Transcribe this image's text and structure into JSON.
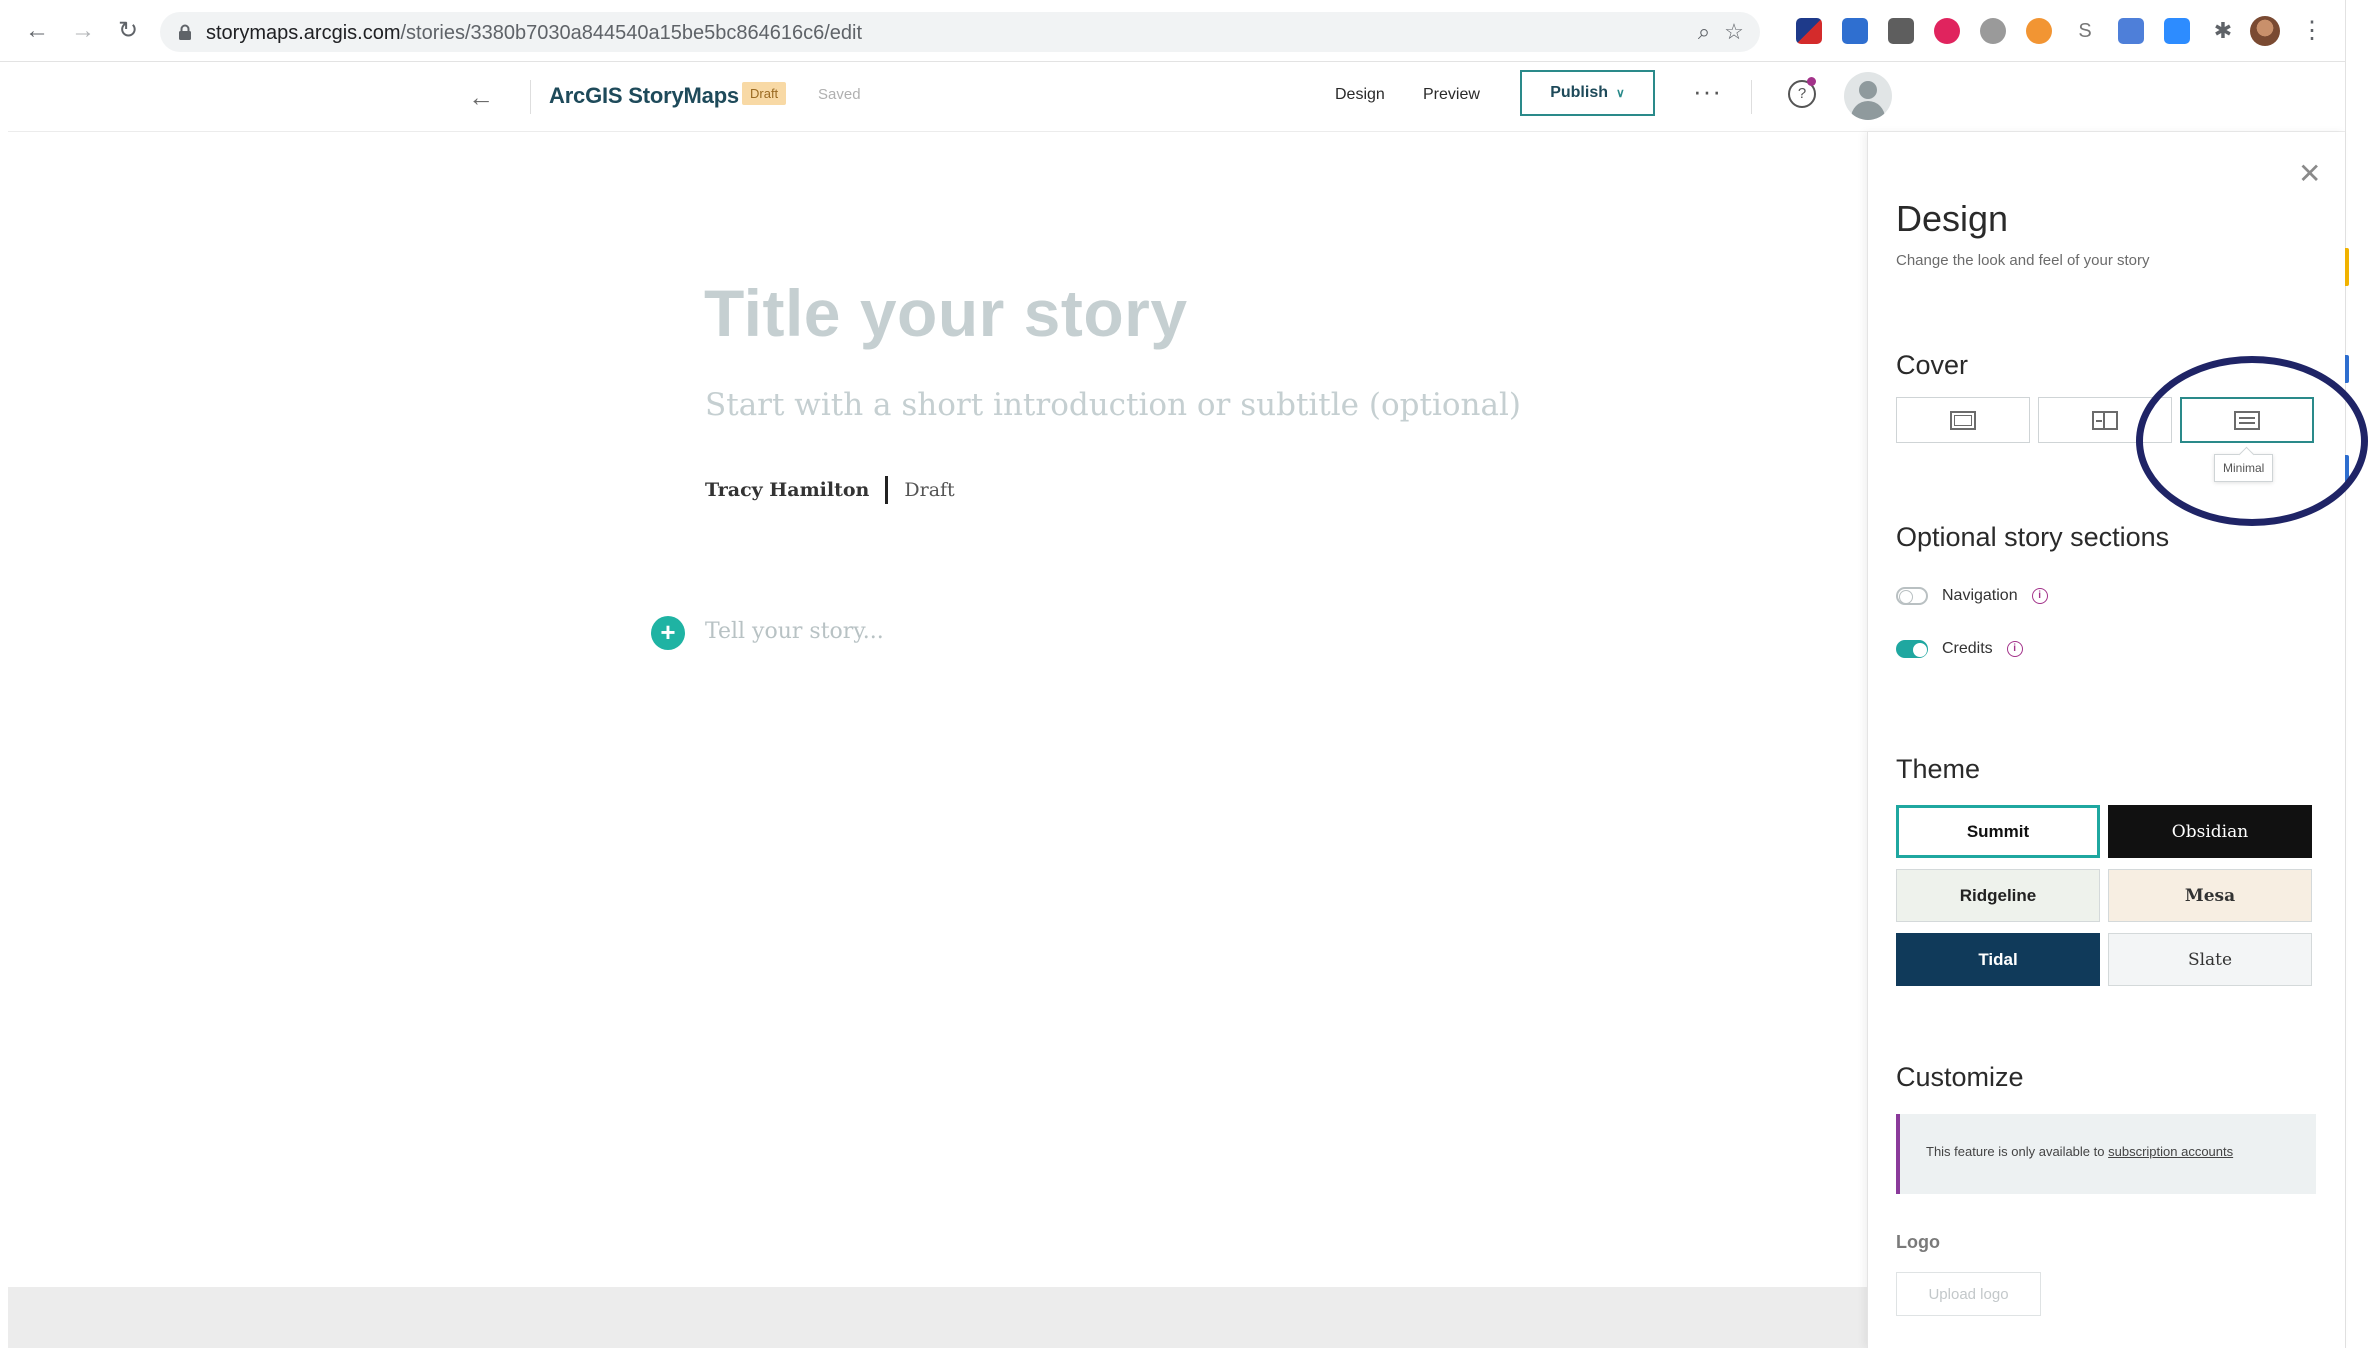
{
  "browser": {
    "url_host": "storymaps.arcgis.com",
    "url_path": "/stories/3380b7030a844540a15be5bc864616c6/edit",
    "icons": [
      "back-icon",
      "forward-icon",
      "reload-icon",
      "lock-icon",
      "zoom-icon",
      "bookmark-star-icon",
      "extensions-icon",
      "kebab-menu-icon"
    ]
  },
  "header": {
    "brand": "ArcGIS StoryMaps",
    "status_badge": "Draft",
    "save_state": "Saved",
    "design_link": "Design",
    "preview_link": "Preview",
    "publish_label": "Publish",
    "more_label": "···",
    "help_label": "?"
  },
  "story": {
    "title_placeholder": "Title your story",
    "subtitle_placeholder": "Start with a short introduction or subtitle (optional)",
    "author": "Tracy Hamilton",
    "status": "Draft",
    "body_placeholder": "Tell your story..."
  },
  "design_panel": {
    "title": "Design",
    "subtitle": "Change the look and feel of your story",
    "cover": {
      "heading": "Cover",
      "options": [
        "full",
        "sidebyside",
        "minimal"
      ],
      "selected": "minimal",
      "tooltip": "Minimal"
    },
    "optional_sections": {
      "heading": "Optional story sections",
      "navigation_label": "Navigation",
      "navigation_on": false,
      "credits_label": "Credits",
      "credits_on": true
    },
    "theme": {
      "heading": "Theme",
      "options": [
        "Summit",
        "Obsidian",
        "Ridgeline",
        "Mesa",
        "Tidal",
        "Slate"
      ],
      "selected": "Summit"
    },
    "customize": {
      "heading": "Customize",
      "note_text": "This feature is only available to",
      "note_link": "subscription accounts",
      "logo_label": "Logo",
      "upload_label": "Upload logo"
    }
  },
  "colors": {
    "accent_teal": "#1fa7a0",
    "brand_navy": "#1e4a5a",
    "annotation_ring": "#1f2466",
    "info_purple": "#a3338a"
  }
}
